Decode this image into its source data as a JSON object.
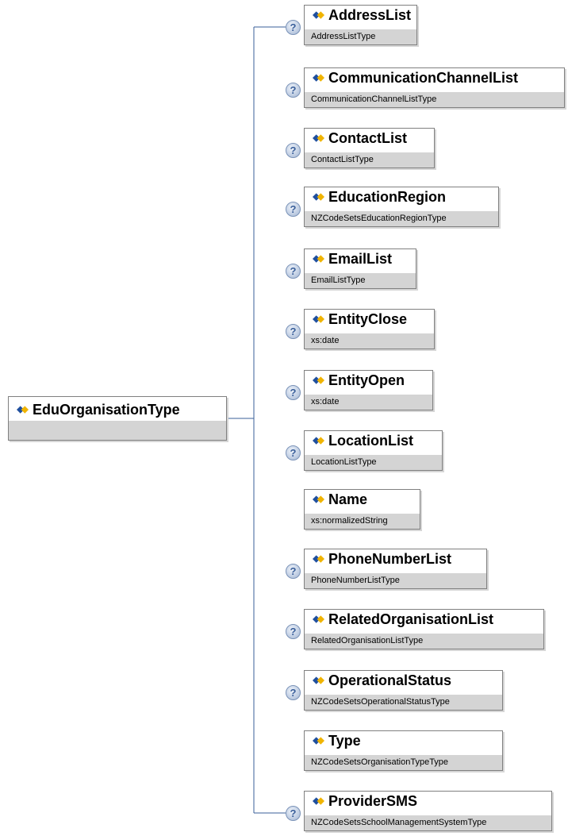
{
  "root": {
    "name": "EduOrganisationType",
    "type": "",
    "icon": "element-icon"
  },
  "help_glyph": "?",
  "elements": [
    {
      "name": "AddressList",
      "type": "AddressListType",
      "has_help": true
    },
    {
      "name": "CommunicationChannelList",
      "type": "CommunicationChannelListType",
      "has_help": true
    },
    {
      "name": "ContactList",
      "type": "ContactListType",
      "has_help": true
    },
    {
      "name": "EducationRegion",
      "type": "NZCodeSetsEducationRegionType",
      "has_help": true
    },
    {
      "name": "EmailList",
      "type": "EmailListType",
      "has_help": true
    },
    {
      "name": "EntityClose",
      "type": "xs:date",
      "has_help": true
    },
    {
      "name": "EntityOpen",
      "type": "xs:date",
      "has_help": true
    },
    {
      "name": "LocationList",
      "type": "LocationListType",
      "has_help": true
    },
    {
      "name": "Name",
      "type": "xs:normalizedString",
      "has_help": false
    },
    {
      "name": "PhoneNumberList",
      "type": "PhoneNumberListType",
      "has_help": true
    },
    {
      "name": "RelatedOrganisationList",
      "type": "RelatedOrganisationListType",
      "has_help": true
    },
    {
      "name": "OperationalStatus",
      "type": "NZCodeSetsOperationalStatusType",
      "has_help": true
    },
    {
      "name": "Type",
      "type": "NZCodeSetsOrganisationTypeType",
      "has_help": false
    },
    {
      "name": "ProviderSMS",
      "type": "NZCodeSetsSchoolManagementSystemType",
      "has_help": true
    }
  ],
  "colors": {
    "connector": "#3a5f9a",
    "type_band": "#d4d4d4",
    "icon_blue": "#1f4f9e",
    "icon_gold": "#f0b400"
  }
}
